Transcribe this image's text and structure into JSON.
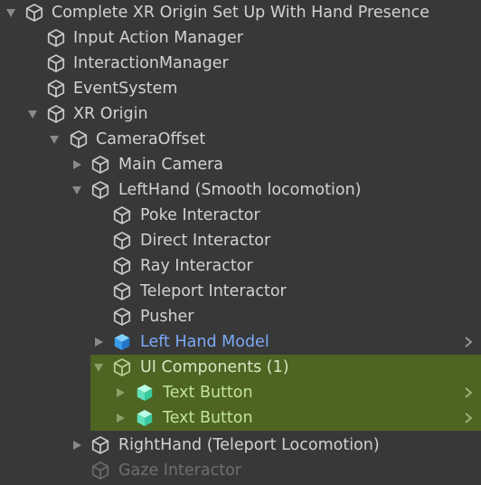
{
  "hierarchy": {
    "items": [
      {
        "label": "Complete XR Origin Set Up With Hand Presence",
        "expanded": true,
        "icon": "gameobject-icon"
      },
      {
        "label": "Input Action Manager",
        "icon": "gameobject-icon"
      },
      {
        "label": "InteractionManager",
        "icon": "gameobject-icon"
      },
      {
        "label": "EventSystem",
        "icon": "gameobject-icon"
      },
      {
        "label": "XR Origin",
        "expanded": true,
        "icon": "gameobject-icon"
      },
      {
        "label": "CameraOffset",
        "expanded": true,
        "icon": "gameobject-icon"
      },
      {
        "label": "Main Camera",
        "expanded": false,
        "icon": "gameobject-icon"
      },
      {
        "label": "LeftHand (Smooth locomotion)",
        "expanded": true,
        "icon": "gameobject-icon"
      },
      {
        "label": "Poke Interactor",
        "icon": "gameobject-icon"
      },
      {
        "label": "Direct Interactor",
        "icon": "gameobject-icon"
      },
      {
        "label": "Ray Interactor",
        "icon": "gameobject-icon"
      },
      {
        "label": "Teleport Interactor",
        "icon": "gameobject-icon"
      },
      {
        "label": "Pusher",
        "icon": "gameobject-icon"
      },
      {
        "label": "Left Hand Model",
        "expanded": false,
        "icon": "prefab-icon"
      },
      {
        "label": "UI Components (1)",
        "expanded": true,
        "icon": "gameobject-icon"
      },
      {
        "label": "Text Button",
        "expanded": false,
        "icon": "prefab-icon"
      },
      {
        "label": "Text Button",
        "expanded": false,
        "icon": "prefab-icon"
      },
      {
        "label": "RightHand (Teleport Locomotion)",
        "expanded": false,
        "icon": "gameobject-icon"
      },
      {
        "label": "Gaze Interactor",
        "icon": "gameobject-icon",
        "disabled": true
      }
    ]
  },
  "colors": {
    "background": "#383838",
    "text": "#d2d2d2",
    "prefab_text": "#7baaf7",
    "prefab_icon": "#4aa8f0",
    "selection_green": "#4e6422",
    "disabled_text": "#6f6f6f"
  }
}
